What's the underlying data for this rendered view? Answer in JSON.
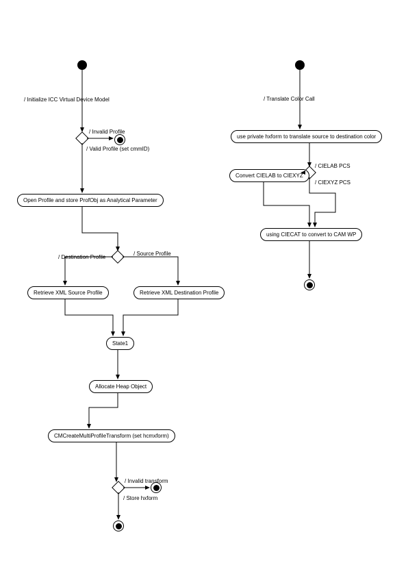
{
  "chart_data": [
    {
      "type": "activity-diagram",
      "title": "",
      "nodes": [
        {
          "id": "start1",
          "type": "initial"
        },
        {
          "id": "d1",
          "type": "decision"
        },
        {
          "id": "end_invalid_profile",
          "type": "final"
        },
        {
          "id": "a_open_profile",
          "type": "activity",
          "label": "Open Profile and store ProfObj as Analytical Parameter"
        },
        {
          "id": "d2",
          "type": "decision"
        },
        {
          "id": "a_xml_src",
          "type": "activity",
          "label": "Retrieve XML Source Profile"
        },
        {
          "id": "a_xml_dst",
          "type": "activity",
          "label": "Retrieve XML Destination Profile"
        },
        {
          "id": "a_state1",
          "type": "activity",
          "label": "State1"
        },
        {
          "id": "a_alloc",
          "type": "activity",
          "label": "Allocate Heap Object"
        },
        {
          "id": "a_cmcreate",
          "type": "activity",
          "label": "CMCreateMultiProfileTransform (set hcmxform)"
        },
        {
          "id": "d3",
          "type": "decision"
        },
        {
          "id": "end_invalid_transform",
          "type": "final"
        },
        {
          "id": "end_store",
          "type": "final"
        }
      ],
      "edges": [
        {
          "from": "start1",
          "to": "d1",
          "label": "/ Initialize ICC Virtual Device Model"
        },
        {
          "from": "d1",
          "to": "end_invalid_profile",
          "label": "/ Invalid Profile"
        },
        {
          "from": "d1",
          "to": "a_open_profile",
          "label": "/ Valid Profile (set cmmID)"
        },
        {
          "from": "a_open_profile",
          "to": "d2"
        },
        {
          "from": "d2",
          "to": "a_xml_src",
          "label": "/ Destination Profile"
        },
        {
          "from": "d2",
          "to": "a_xml_dst",
          "label": "/ Source Profile"
        },
        {
          "from": "a_xml_src",
          "to": "a_state1"
        },
        {
          "from": "a_xml_dst",
          "to": "a_state1"
        },
        {
          "from": "a_state1",
          "to": "a_alloc"
        },
        {
          "from": "a_alloc",
          "to": "a_cmcreate"
        },
        {
          "from": "a_cmcreate",
          "to": "d3"
        },
        {
          "from": "d3",
          "to": "end_invalid_transform",
          "label": "/ Invalid transform"
        },
        {
          "from": "d3",
          "to": "end_store",
          "label": "/ Store hxform"
        }
      ]
    },
    {
      "type": "activity-diagram",
      "title": "",
      "nodes": [
        {
          "id": "start2",
          "type": "initial"
        },
        {
          "id": "a_use_private",
          "type": "activity",
          "label": "use private hxform to translate source to destination color"
        },
        {
          "id": "d4",
          "type": "decision"
        },
        {
          "id": "a_convert_lab",
          "type": "activity",
          "label": "Convert CIELAB to CIEXYZ"
        },
        {
          "id": "a_ciecat",
          "type": "activity",
          "label": "using CIECAT to convert to CAM WP"
        },
        {
          "id": "end2",
          "type": "final"
        }
      ],
      "edges": [
        {
          "from": "start2",
          "to": "a_use_private",
          "label": "/ Translate Color Call"
        },
        {
          "from": "a_use_private",
          "to": "d4"
        },
        {
          "from": "d4",
          "to": "a_convert_lab",
          "label": "/ CIELAB PCS"
        },
        {
          "from": "d4",
          "to": "a_ciecat",
          "label": "/ CIEXYZ PCS"
        },
        {
          "from": "a_convert_lab",
          "to": "a_ciecat"
        },
        {
          "from": "a_ciecat",
          "to": "end2"
        }
      ]
    }
  ],
  "labels": {
    "init_icc": "/ Initialize ICC Virtual Device Model",
    "invalid_profile": "/ Invalid Profile",
    "valid_profile": "/ Valid Profile (set cmmID)",
    "open_profile": "Open Profile and store ProfObj as Analytical Parameter",
    "dest_profile": "/ Destination Profile",
    "source_profile": "/ Source Profile",
    "xml_src": "Retrieve XML Source Profile",
    "xml_dst": "Retrieve XML Destination Profile",
    "state1": "State1",
    "alloc": "Allocate Heap Object",
    "cmcreate": "CMCreateMultiProfileTransform (set hcmxform)",
    "invalid_transform": "/ Invalid transform",
    "store_hxform": "/ Store hxform",
    "translate_call": "/ Translate Color Call",
    "use_private": "use private hxform to translate source to destination color",
    "cielab_pcs": "/ CIELAB PCS",
    "ciexyz_pcs": "/ CIEXYZ PCS",
    "convert_lab": "Convert CIELAB to CIEXYZ",
    "ciecat": "using CIECAT to convert to CAM WP"
  }
}
